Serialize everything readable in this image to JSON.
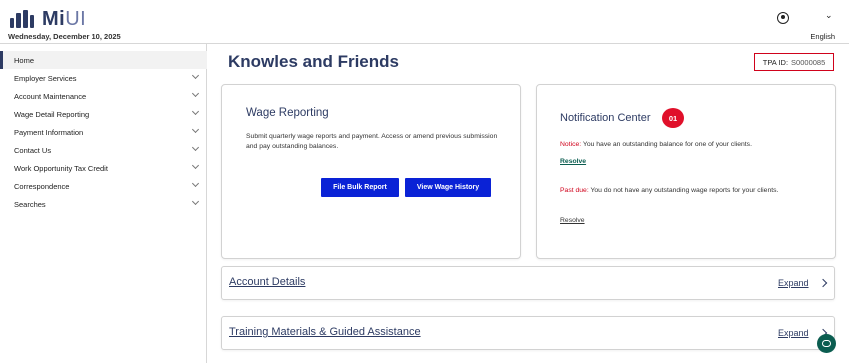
{
  "header": {
    "logo_text": "Mi",
    "logo_text_accent": "UI",
    "date": "Wednesday, December 10, 2025",
    "profile_icon": "user-circle-icon",
    "language": "English"
  },
  "sidebar": {
    "items": [
      {
        "label": "Home",
        "active": true,
        "has_caret": false
      },
      {
        "label": "Employer Services",
        "active": false,
        "has_caret": true
      },
      {
        "label": "Account Maintenance",
        "active": false,
        "has_caret": true
      },
      {
        "label": "Wage Detail Reporting",
        "active": false,
        "has_caret": true
      },
      {
        "label": "Payment Information",
        "active": false,
        "has_caret": true
      },
      {
        "label": "Contact Us",
        "active": false,
        "has_caret": true
      },
      {
        "label": "Work Opportunity Tax Credit",
        "active": false,
        "has_caret": true
      },
      {
        "label": "Correspondence",
        "active": false,
        "has_caret": true
      },
      {
        "label": "Searches",
        "active": false,
        "has_caret": true
      }
    ]
  },
  "main": {
    "title": "Knowles and Friends",
    "tpa": {
      "label": "TPA ID:",
      "value": "S0000085"
    },
    "wage_card": {
      "title": "Wage Reporting",
      "description": "Submit quarterly wage reports and payment. Access or amend previous submission and pay outstanding balances.",
      "bulk_button": "File Bulk Report",
      "history_button": "View Wage History"
    },
    "notification_card": {
      "title": "Notification Center",
      "badge": "01",
      "notice_tag": "Notice:",
      "notice_text": " You have an outstanding balance for one of your clients.",
      "resolve_1": "Resolve",
      "pastdue_tag": "Past due:",
      "pastdue_text": " You do not have any outstanding wage reports for your clients.",
      "resolve_2": "Resolve"
    },
    "accordions": [
      {
        "title": "Account Details",
        "expand": "Expand"
      },
      {
        "title": "Training Materials & Guided Assistance",
        "expand": "Expand"
      }
    ]
  },
  "colors": {
    "brand": "#2d3b63",
    "button": "#0a22d6",
    "alert": "#d0021b",
    "badge": "#e0102a",
    "resolve": "#0b5d50"
  },
  "chat": {
    "icon": "chat-bubble-icon"
  }
}
